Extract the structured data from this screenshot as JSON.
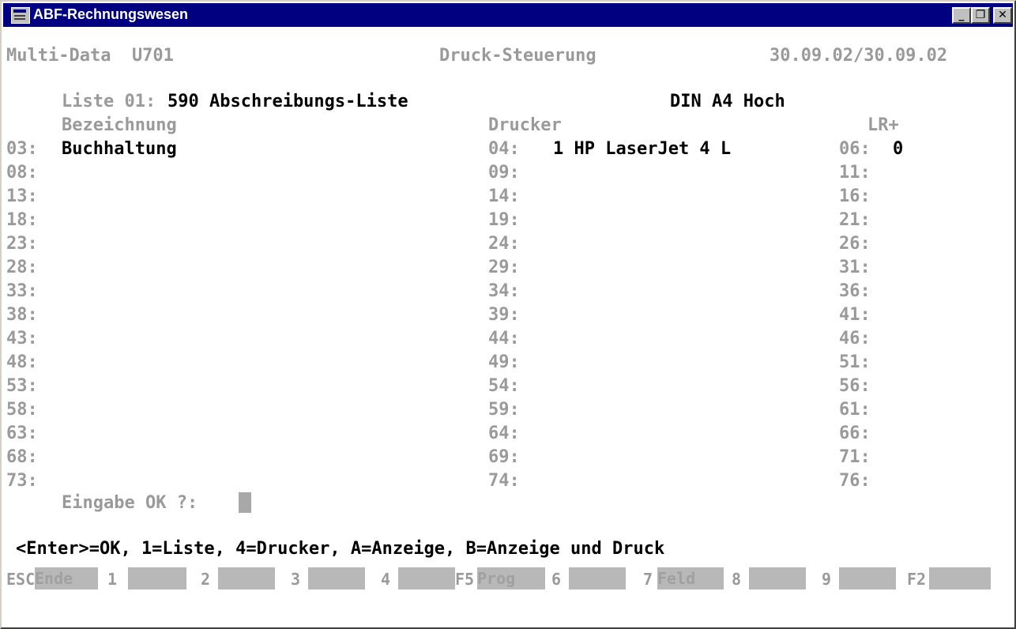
{
  "window": {
    "title": "ABF-Rechnungswesen",
    "buttons": {
      "minimize": "_",
      "maximize": "❐",
      "close": "✕"
    }
  },
  "header": {
    "left": "Multi-Data  U701",
    "center": "Druck-Steuerung",
    "right": "30.09.02/30.09.02"
  },
  "list": {
    "label": "Liste 01:",
    "value": "590 Abschreibungs-Liste",
    "format": "DIN A4 Hoch"
  },
  "columns": {
    "bezeichnung": "Bezeichnung",
    "drucker": "Drucker",
    "lr": "LR+"
  },
  "rows": [
    {
      "a": "03:",
      "a_val": "Buchhaltung",
      "b": "04:",
      "b_val": "1 HP LaserJet 4 L",
      "c": "06:",
      "c_val": "0"
    },
    {
      "a": "08:",
      "a_val": "",
      "b": "09:",
      "b_val": "",
      "c": "11:",
      "c_val": ""
    },
    {
      "a": "13:",
      "a_val": "",
      "b": "14:",
      "b_val": "",
      "c": "16:",
      "c_val": ""
    },
    {
      "a": "18:",
      "a_val": "",
      "b": "19:",
      "b_val": "",
      "c": "21:",
      "c_val": ""
    },
    {
      "a": "23:",
      "a_val": "",
      "b": "24:",
      "b_val": "",
      "c": "26:",
      "c_val": ""
    },
    {
      "a": "28:",
      "a_val": "",
      "b": "29:",
      "b_val": "",
      "c": "31:",
      "c_val": ""
    },
    {
      "a": "33:",
      "a_val": "",
      "b": "34:",
      "b_val": "",
      "c": "36:",
      "c_val": ""
    },
    {
      "a": "38:",
      "a_val": "",
      "b": "39:",
      "b_val": "",
      "c": "41:",
      "c_val": ""
    },
    {
      "a": "43:",
      "a_val": "",
      "b": "44:",
      "b_val": "",
      "c": "46:",
      "c_val": ""
    },
    {
      "a": "48:",
      "a_val": "",
      "b": "49:",
      "b_val": "",
      "c": "51:",
      "c_val": ""
    },
    {
      "a": "53:",
      "a_val": "",
      "b": "54:",
      "b_val": "",
      "c": "56:",
      "c_val": ""
    },
    {
      "a": "58:",
      "a_val": "",
      "b": "59:",
      "b_val": "",
      "c": "61:",
      "c_val": ""
    },
    {
      "a": "63:",
      "a_val": "",
      "b": "64:",
      "b_val": "",
      "c": "66:",
      "c_val": ""
    },
    {
      "a": "68:",
      "a_val": "",
      "b": "69:",
      "b_val": "",
      "c": "71:",
      "c_val": ""
    },
    {
      "a": "73:",
      "a_val": "",
      "b": "74:",
      "b_val": "",
      "c": "76:",
      "c_val": ""
    }
  ],
  "prompt": {
    "label": "Eingabe OK ?:",
    "value": ""
  },
  "help": "<Enter>=OK, 1=Liste, 4=Drucker, A=Anzeige, B=Anzeige und Druck",
  "fkeys": [
    {
      "key": "ESC",
      "label": "Ende"
    },
    {
      "key": "1",
      "label": ""
    },
    {
      "key": "2",
      "label": ""
    },
    {
      "key": "3",
      "label": ""
    },
    {
      "key": "4",
      "label": ""
    },
    {
      "key": "F5",
      "label": "Prog"
    },
    {
      "key": "6",
      "label": ""
    },
    {
      "key": "7",
      "label": "Feld"
    },
    {
      "key": "8",
      "label": ""
    },
    {
      "key": "9",
      "label": ""
    },
    {
      "key": "F2",
      "label": ""
    }
  ],
  "colors": {
    "titlebar": "#000080",
    "label": "#9a9a9a",
    "value": "#000000",
    "fkey_bg": "#b8b8b8"
  }
}
